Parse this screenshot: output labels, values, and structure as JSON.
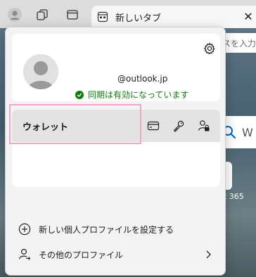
{
  "tab": {
    "title": "新しいタブ",
    "close_glyph": "✕"
  },
  "page": {
    "address_placeholder": "スを入力",
    "search_hint": "W",
    "m365_text": "t 365"
  },
  "profile": {
    "email": "@outlook.jp",
    "sync_status": "同期は有効になっています"
  },
  "wallet": {
    "label": "ウォレット",
    "icons": [
      "card-icon",
      "key-icon",
      "password-lock-icon"
    ]
  },
  "menu": {
    "add_profile": "新しい個人プロファイルを設定する",
    "other_profiles": "その他のプロファイル"
  },
  "colors": {
    "sync_green": "#107c10",
    "highlight_pink": "#f0a6c8",
    "flyout_bg": "#f3f3f3"
  }
}
